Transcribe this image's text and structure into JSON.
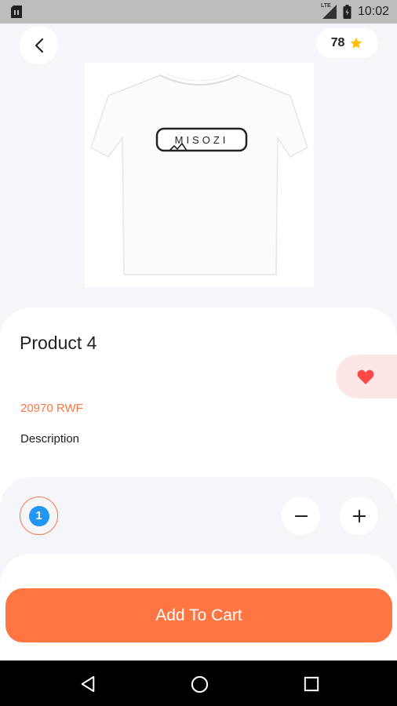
{
  "status_bar": {
    "time": "10:02",
    "left_icon": "sim-card-icon",
    "network_label": "LTE",
    "icons": [
      "signal-icon",
      "battery-icon"
    ]
  },
  "header": {
    "back_icon": "chevron-left-icon",
    "rating": "78",
    "rating_icon": "star-icon",
    "rating_color": "#ffc107"
  },
  "product": {
    "image_name": "white-tshirt-image",
    "image_brand_text": "MISOZI",
    "title": "Product 4",
    "price": "20970 RWF",
    "description_label": "Description",
    "favorite_icon": "heart-icon",
    "favorite_color": "#ff4848"
  },
  "quantity": {
    "value": "1",
    "decrement_icon": "minus-icon",
    "increment_icon": "plus-icon"
  },
  "actions": {
    "add_to_cart_label": "Add To Cart"
  },
  "nav": {
    "back_icon": "triangle-back-icon",
    "home_icon": "circle-home-icon",
    "recents_icon": "square-recents-icon"
  },
  "colors": {
    "accent": "#ff7643",
    "background": "#f5f6f9",
    "quantity_dot": "#2196f3"
  }
}
